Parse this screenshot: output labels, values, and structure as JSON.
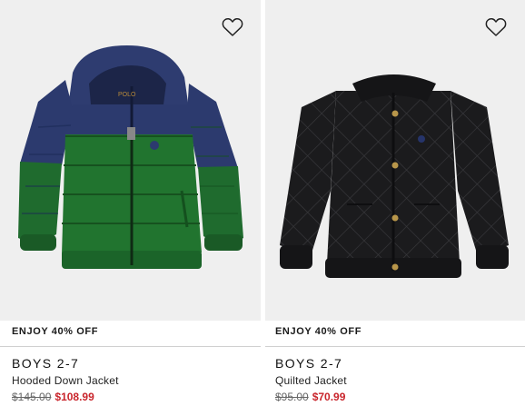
{
  "products": [
    {
      "promo": "ENJOY 40% OFF",
      "brand": "BOYS 2-7",
      "name": "Hooded Down Jacket",
      "original_price": "$145.00",
      "sale_price": "$108.99",
      "logo_text": "POLO"
    },
    {
      "promo": "ENJOY 40% OFF",
      "brand": "BOYS 2-7",
      "name": "Quilted Jacket",
      "original_price": "$95.00",
      "sale_price": "$70.99"
    }
  ],
  "colors": {
    "image_background": "#efefef",
    "sale_price": "#c9252c",
    "divider": "#d0d0d0",
    "down_jacket_navy": "#2c3a6e",
    "down_jacket_green": "#1f6b2e",
    "quilted_jacket_black": "#1b1b1d"
  },
  "icons": {
    "wishlist": "heart-outline-icon"
  }
}
